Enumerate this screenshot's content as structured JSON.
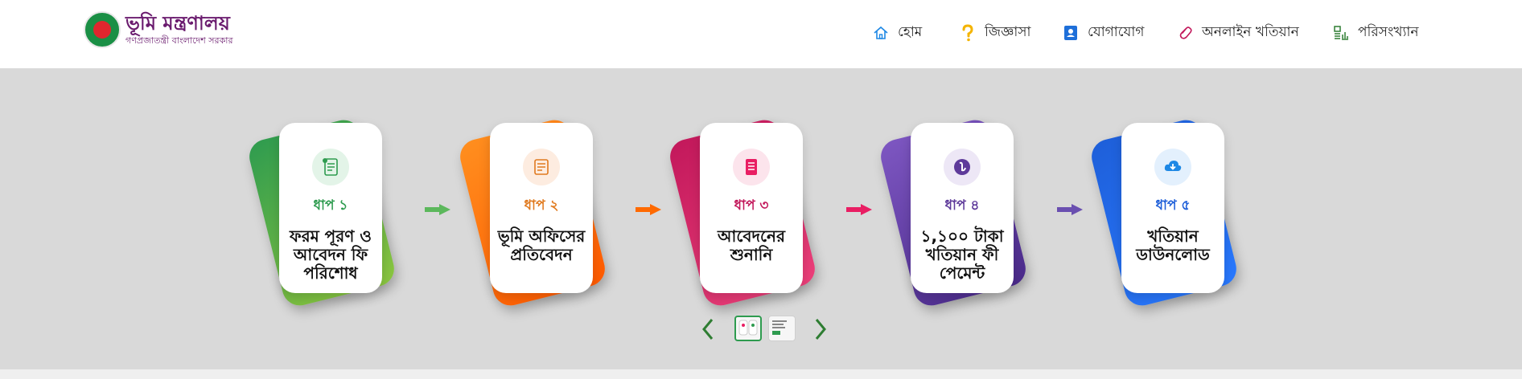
{
  "header": {
    "logo_title": "ভূমি মন্ত্রণালয়",
    "logo_subtitle": "গণপ্রজাতন্ত্রী বাংলাদেশ সরকার",
    "nav": [
      {
        "label": "হোম",
        "icon": "home-icon"
      },
      {
        "label": "জিজ্ঞাসা",
        "icon": "question-icon"
      },
      {
        "label": "যোগাযোগ",
        "icon": "contact-book-icon"
      },
      {
        "label": "অনলাইন খতিয়ান",
        "icon": "link-icon"
      },
      {
        "label": "পরিসংখ্যান",
        "icon": "statistics-icon"
      }
    ]
  },
  "steps": [
    {
      "step": "ধাপ ১",
      "title": "ফরম পূরণ ও আবেদন ফি পরিশোধ",
      "color": "#2e9b4f",
      "accent": "#8cc63f",
      "icon": "form-fill-icon"
    },
    {
      "step": "ধাপ ২",
      "title": "ভূমি অফিসের প্রতিবেদন",
      "color": "#e07a1f",
      "accent": "#ff5a00",
      "icon": "office-report-icon"
    },
    {
      "step": "ধাপ ৩",
      "title": "আবেদনের শুনানি",
      "color": "#c2185b",
      "accent": "#ec407a",
      "icon": "hearing-checklist-icon"
    },
    {
      "step": "ধাপ ৪",
      "title": "১,১০০ টাকা খতিয়ান ফী পেমেন্ট",
      "color": "#5e3a9a",
      "accent": "#7e57c2",
      "icon": "taka-payment-icon"
    },
    {
      "step": "ধাপ ৫",
      "title": "খতিয়ান ডাউনলোড",
      "color": "#1e5fd9",
      "accent": "#2979ff",
      "icon": "cloud-download-icon"
    }
  ],
  "carousel": {
    "prev_icon": "chevron-left-icon",
    "next_icon": "chevron-right-icon",
    "active_index": 0
  }
}
